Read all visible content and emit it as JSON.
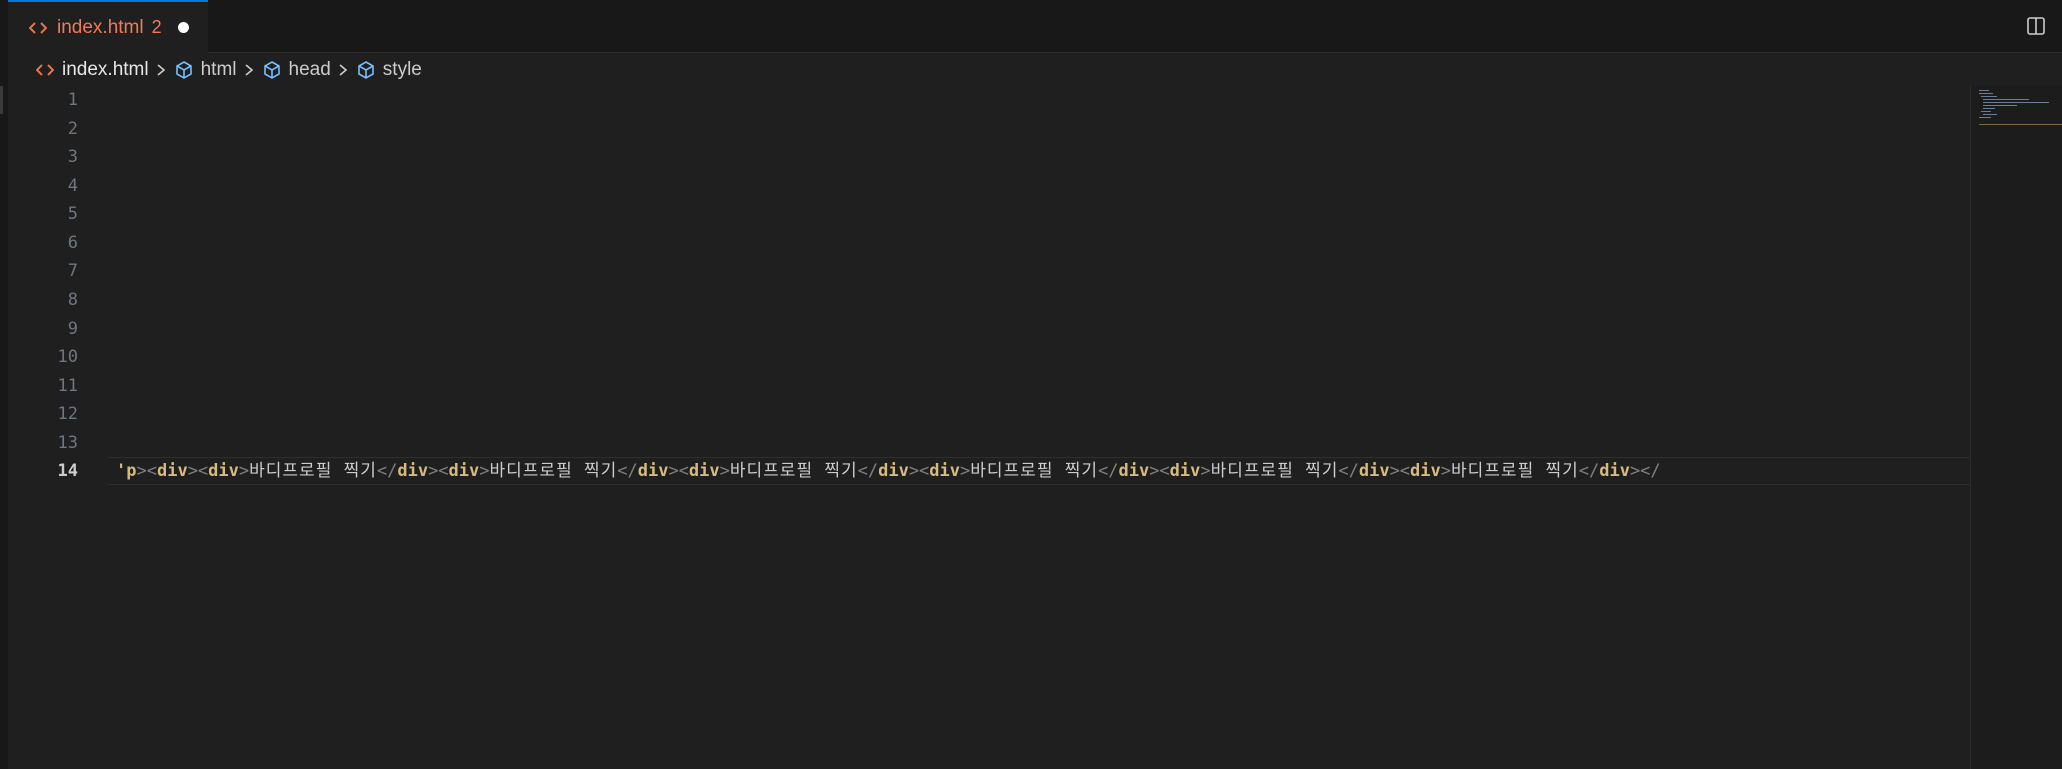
{
  "tab": {
    "icon": "html-file-icon",
    "label": "index.html",
    "badge": "2",
    "dirty": true
  },
  "toolbar": {
    "split_icon": "split-editor-icon"
  },
  "breadcrumbs": [
    {
      "label": "index.html",
      "icon": "html-file-icon"
    },
    {
      "label": "html",
      "icon": "symbol-element-icon"
    },
    {
      "label": "head",
      "icon": "symbol-element-icon"
    },
    {
      "label": "style",
      "icon": "symbol-element-icon"
    }
  ],
  "editor": {
    "line_numbers": [
      "1",
      "2",
      "3",
      "4",
      "5",
      "6",
      "7",
      "8",
      "9",
      "10",
      "11",
      "12",
      "13",
      "14"
    ],
    "active_line": "14",
    "line14_segments": [
      {
        "t": "'p",
        "k": "tag"
      },
      {
        "t": "><",
        "k": "punc"
      },
      {
        "t": "div",
        "k": "tag"
      },
      {
        "t": "><",
        "k": "punc"
      },
      {
        "t": "div",
        "k": "tag"
      },
      {
        "t": ">",
        "k": "punc"
      },
      {
        "t": "바디프로필 찍기",
        "k": "text"
      },
      {
        "t": "</",
        "k": "punc"
      },
      {
        "t": "div",
        "k": "tag"
      },
      {
        "t": "><",
        "k": "punc"
      },
      {
        "t": "div",
        "k": "tag"
      },
      {
        "t": ">",
        "k": "punc"
      },
      {
        "t": "바디프로필 찍기",
        "k": "text"
      },
      {
        "t": "</",
        "k": "punc"
      },
      {
        "t": "div",
        "k": "tag"
      },
      {
        "t": "><",
        "k": "punc"
      },
      {
        "t": "div",
        "k": "tag"
      },
      {
        "t": ">",
        "k": "punc"
      },
      {
        "t": "바디프로필 찍기",
        "k": "text"
      },
      {
        "t": "</",
        "k": "punc"
      },
      {
        "t": "div",
        "k": "tag"
      },
      {
        "t": "><",
        "k": "punc"
      },
      {
        "t": "div",
        "k": "tag"
      },
      {
        "t": ">",
        "k": "punc"
      },
      {
        "t": "바디프로필 찍기",
        "k": "text"
      },
      {
        "t": "</",
        "k": "punc"
      },
      {
        "t": "div",
        "k": "tag"
      },
      {
        "t": "><",
        "k": "punc"
      },
      {
        "t": "div",
        "k": "tag"
      },
      {
        "t": ">",
        "k": "punc"
      },
      {
        "t": "바디프로필 찍기",
        "k": "text"
      },
      {
        "t": "</",
        "k": "punc"
      },
      {
        "t": "div",
        "k": "tag"
      },
      {
        "t": "><",
        "k": "punc"
      },
      {
        "t": "div",
        "k": "tag"
      },
      {
        "t": ">",
        "k": "punc"
      },
      {
        "t": "바디프로필 찍기",
        "k": "text"
      },
      {
        "t": "</",
        "k": "punc"
      },
      {
        "t": "div",
        "k": "tag"
      },
      {
        "t": "></",
        "k": "punc"
      }
    ]
  },
  "colors": {
    "background": "#1f1f1f",
    "tab_text": "#f07a5a",
    "tag": "#d7ba7d",
    "punctuation": "#808080",
    "text": "#cccccc",
    "line_number": "#6e7681",
    "symbol_icon": "#75beff"
  }
}
